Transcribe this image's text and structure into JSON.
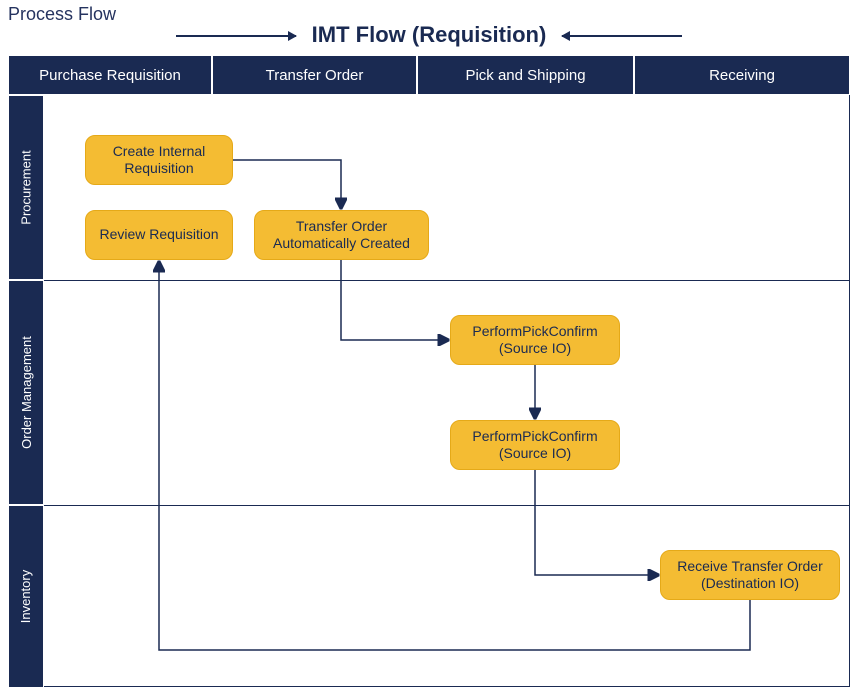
{
  "diagram": {
    "corner_label": "Process Flow",
    "title": "IMT Flow (Requisition)",
    "columns": [
      "Purchase Requisition",
      "Transfer Order",
      "Pick and Shipping",
      "Receiving"
    ],
    "swimlanes": [
      "Procurement",
      "Order Management",
      "Inventory"
    ],
    "steps": {
      "create_internal_requisition": "Create Internal Requisition",
      "review_requisition": "Review Requisition",
      "transfer_order_auto": "Transfer Order Automatically Created",
      "pick_confirm_1": "PerformPickConfirm (Source IO)",
      "pick_confirm_2": "PerformPickConfirm (Source IO)",
      "receive_transfer": "Receive Transfer Order (Destination IO)"
    },
    "colors": {
      "navy": "#1a2a52",
      "amber": "#f4bc33"
    }
  }
}
